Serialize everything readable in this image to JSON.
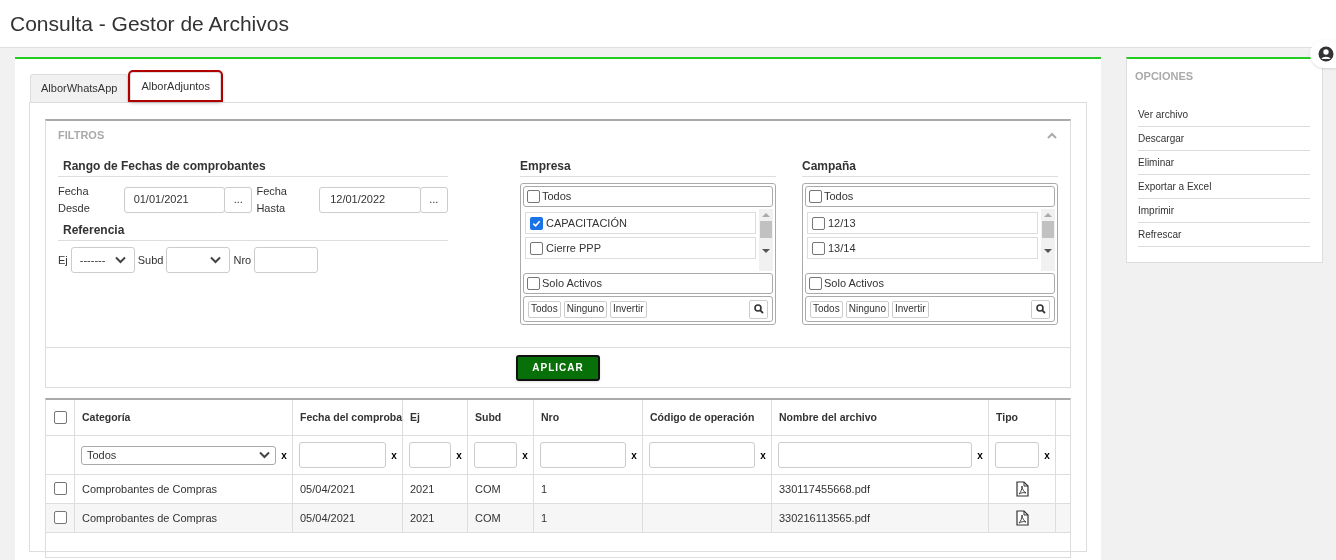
{
  "page_title": "Consulta - Gestor de Archivos",
  "tabs": [
    {
      "label": "AlborWhatsApp",
      "selected": false
    },
    {
      "label": "AlborAdjuntos",
      "selected": true
    }
  ],
  "filters": {
    "title": "FILTROS",
    "expanded": true,
    "date_range": {
      "heading": "Rango de Fechas de comprobantes",
      "from_label": "Fecha Desde",
      "from_value": "01/01/2021",
      "to_label": "Fecha Hasta",
      "to_value": "12/01/2022",
      "picker_label": "..."
    },
    "reference": {
      "heading": "Referencia",
      "ej_label": "Ej",
      "ej_value": "-------",
      "subd_label": "Subd",
      "nro_label": "Nro"
    },
    "lists": [
      {
        "heading": "Empresa",
        "all": {
          "label": "Todos",
          "checked": false
        },
        "items": [
          {
            "label": "CAPACITACIÓN",
            "checked": true
          },
          {
            "label": "Cierre PPP",
            "checked": false
          }
        ],
        "only_active": {
          "label": "Solo Activos",
          "checked": false
        },
        "buttons": [
          "Todos",
          "Ninguno",
          "Invertir"
        ]
      },
      {
        "heading": "Campaña",
        "all": {
          "label": "Todos",
          "checked": false
        },
        "items": [
          {
            "label": "12/13",
            "checked": false
          },
          {
            "label": "13/14",
            "checked": false
          }
        ],
        "only_active": {
          "label": "Solo Activos",
          "checked": false
        },
        "buttons": [
          "Todos",
          "Ninguno",
          "Invertir"
        ]
      }
    ],
    "apply_button": "APLICAR"
  },
  "table": {
    "select_all": {
      "checked": false
    },
    "columns": [
      {
        "label": "Categoría",
        "kind": "select",
        "filter_value": "Todos",
        "clear": "x"
      },
      {
        "label": "Fecha del comproba",
        "kind": "text",
        "clear": "x"
      },
      {
        "label": "Ej",
        "kind": "text",
        "clear": "x"
      },
      {
        "label": "Subd",
        "kind": "text",
        "clear": "x"
      },
      {
        "label": "Nro",
        "kind": "text",
        "clear": "x"
      },
      {
        "label": "Código de operación",
        "kind": "text",
        "clear": "x"
      },
      {
        "label": "Nombre del archivo",
        "kind": "text",
        "clear": "x"
      },
      {
        "label": "Tipo",
        "kind": "text",
        "clear": "x"
      }
    ],
    "rows": [
      {
        "checked": false,
        "cells": [
          "Comprobantes de Compras",
          "05/04/2021",
          "2021",
          "COM",
          "1",
          "",
          "330117455668.pdf"
        ]
      },
      {
        "checked": false,
        "cells": [
          "Comprobantes de Compras",
          "05/04/2021",
          "2021",
          "COM",
          "1",
          "",
          "330216113565.pdf"
        ]
      }
    ]
  },
  "options": {
    "title": "OPCIONES",
    "items": [
      "Ver archivo",
      "Descargar",
      "Eliminar",
      "Exportar a Excel",
      "Imprimir",
      "Refrescar"
    ]
  }
}
